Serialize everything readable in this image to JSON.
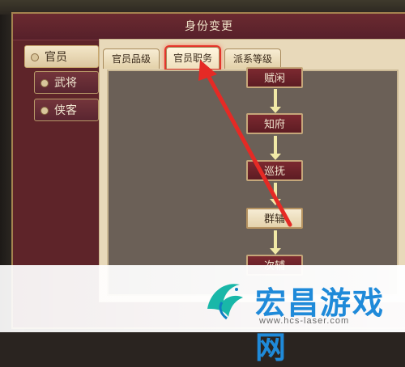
{
  "window": {
    "title": "身份变更"
  },
  "sidebar": {
    "items": [
      {
        "label": "官员",
        "active": true
      },
      {
        "label": "武将",
        "active": false
      },
      {
        "label": "侠客",
        "active": false
      }
    ]
  },
  "tabs": [
    {
      "label": "官员品级",
      "active": false
    },
    {
      "label": "官员职务",
      "active": true
    },
    {
      "label": "派系等级",
      "active": false
    }
  ],
  "ranks": [
    {
      "label": "赋闲"
    },
    {
      "label": "知府"
    },
    {
      "label": "巡抚"
    },
    {
      "label": "群辅",
      "highlighted": true
    },
    {
      "label": "次辅"
    }
  ],
  "watermark": {
    "text": "宏昌游戏网",
    "url": "www.hcs-laser.com"
  },
  "colors": {
    "accent_red": "#e4342b",
    "window_bg": "#5e2429",
    "watermark_blue": "#1f8ad9"
  }
}
